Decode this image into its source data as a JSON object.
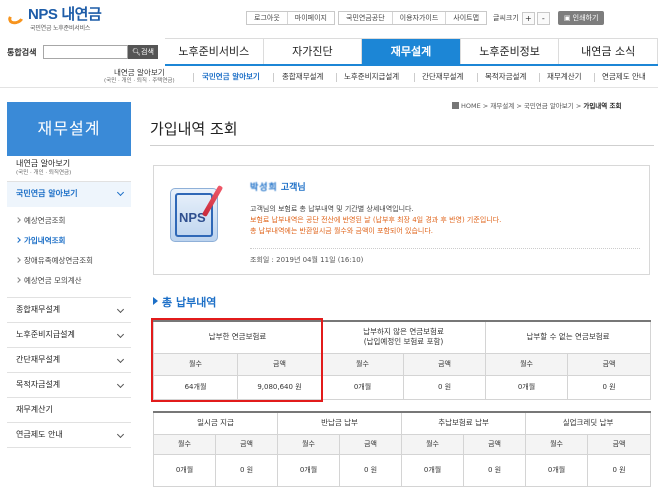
{
  "header": {
    "logo_nps": "NPS",
    "logo_name": "내연금",
    "logo_sub": "국민연금 노후준비서비스",
    "util_links_1": [
      "로그아웃",
      "마이페이지"
    ],
    "util_links_2": [
      "국민연금공단",
      "이용자가이드",
      "사이트맵"
    ],
    "font_label": "글씨크기",
    "font_plus": "+",
    "font_minus": "-",
    "print_label": "인쇄하기"
  },
  "search": {
    "label": "통합검색",
    "placeholder": "",
    "button": "검색"
  },
  "gnb": {
    "tabs": [
      "노후준비서비스",
      "자가진단",
      "재무설계",
      "노후준비정보",
      "내연금 소식"
    ],
    "active_index": 2
  },
  "subnav": {
    "first_line1": "내연금 알아보기",
    "first_line2": "(국민 · 개인 · 퇴직 · 주택연금)",
    "items": [
      "국민연금 알아보기",
      "종합재무설계",
      "노후준비지급설계",
      "간단재무설계",
      "목적자금설계",
      "재무계산기",
      "연금제도 안내"
    ]
  },
  "sidebar": {
    "title": "재무설계",
    "item1_line1": "내연금 알아보기",
    "item1_line2": "(국민 · 개인 · 퇴직연금)",
    "open_item": "국민연금 알아보기",
    "sub_items": [
      "예상연금조회",
      "가입내역조회",
      "장애유족예상연금조회",
      "예상연금 모의계산"
    ],
    "items": [
      "종합재무설계",
      "노후준비지급설계",
      "간단재무설계",
      "목적자금설계",
      "재무계산기",
      "연금제도 안내"
    ]
  },
  "breadcrumb": {
    "home": "HOME",
    "items": [
      "재무설계",
      "국민연금 알아보기"
    ],
    "current": "가입내역 조회"
  },
  "page": {
    "title": "가입내역 조회"
  },
  "info": {
    "user_name": "박성희",
    "user_suffix": "고객님",
    "line1": "고객님의 보험료 총 납부내역 및 기간별 상세내역입니다.",
    "line2": "보험료 납부내역은 공단 전산에 반영된 날 (납부후 최장 4일 경과 후 반영) 기준입니다.",
    "line3": "총 납부내역에는 반환일시금 월수와 금액이 포함되어 있습니다.",
    "query_date": "조회일 : 2019년 04월 11일 (16:10)",
    "icon_text": "NPS"
  },
  "summary": {
    "section_title": "총 납부내역",
    "table1": {
      "groups": [
        {
          "title": "납부한 연금보험료",
          "title2": ""
        },
        {
          "title": "납부하지 않은 연금보험료",
          "title2": "(납입예정인 보험료 포함)"
        },
        {
          "title": "납부할 수 없는 연금보험료",
          "title2": ""
        }
      ],
      "col_months": "월수",
      "col_amount": "금액",
      "values": [
        "64개월",
        "9,080,640 원",
        "0개월",
        "0 원",
        "0개월",
        "0 원"
      ]
    },
    "table2": {
      "groups": [
        "일시금 지급",
        "반납금 납부",
        "추납보험료 납부",
        "실업크레딧 납부"
      ],
      "col_months": "월수",
      "col_amount": "금액",
      "values": [
        "0개월",
        "0 원",
        "0개월",
        "0 원",
        "0개월",
        "0 원",
        "0개월",
        "0 원"
      ]
    }
  },
  "colors": {
    "brand_blue": "#1c86d6",
    "link_blue": "#1c6fc7",
    "notice_orange": "#e0651c",
    "highlight_red": "#e21b1b"
  }
}
